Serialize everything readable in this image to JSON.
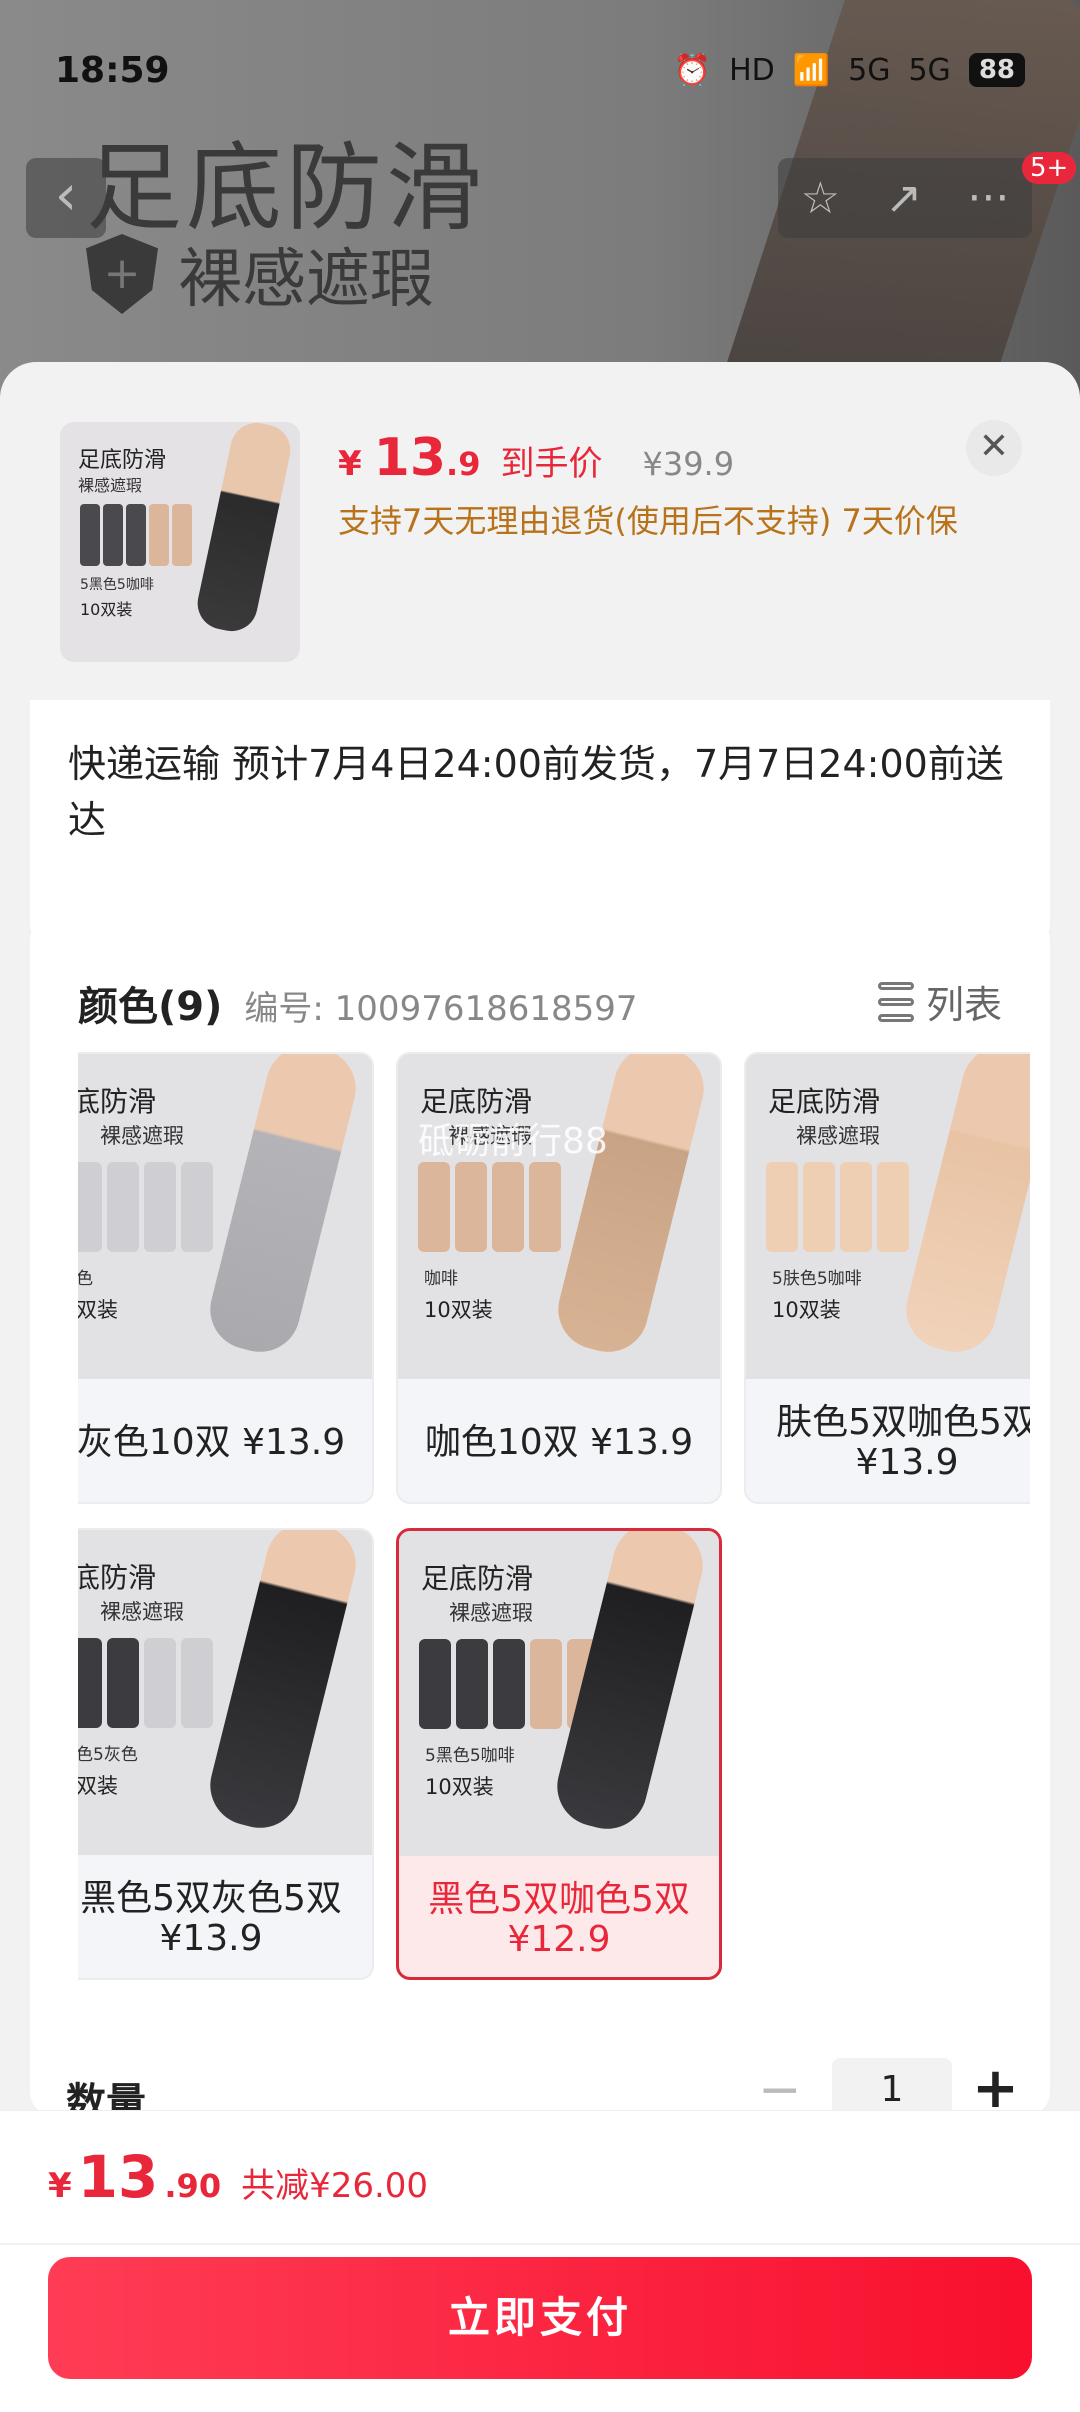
{
  "status_bar": {
    "time": "18:59",
    "hd_label": "HD",
    "network1": "5G",
    "network2": "5G",
    "battery": "88"
  },
  "background": {
    "title": "足底防滑",
    "subtitle": "裸感遮瑕"
  },
  "top_bar": {
    "badge": "5+"
  },
  "product": {
    "thumb_title": "足底防滑",
    "thumb_subtitle": "裸感遮瑕",
    "thumb_line1": "5黑色5咖啡",
    "thumb_line2": "10双装",
    "currency": "¥",
    "price_int": "13",
    "price_dec": ".9",
    "price_tag": "到手价",
    "original_price": "¥39.9",
    "policy": "支持7天无理由退货(使用后不支持) 7天价保"
  },
  "shipping": {
    "text": "快递运输 预计7月4日24:00前发货，7月7日24:00前送达"
  },
  "spec": {
    "title": "颜色(9)",
    "code": "编号: 10097618618597",
    "list_label": "列表",
    "watermark": "砥砺前行88",
    "options": [
      {
        "image_title": "底防滑",
        "image_subtitle": "裸感遮瑕",
        "image_line1": "色",
        "image_line2": "双装",
        "label": "灰色10双 ¥13.9",
        "sock_color": "#cfcfd3",
        "leg_color": "#a9a9ae",
        "selected": false
      },
      {
        "image_title": "足底防滑",
        "image_subtitle": "裸感遮瑕",
        "image_line1": "咖啡",
        "image_line2": "10双装",
        "label": "咖色10双 ¥13.9",
        "sock_color": "#dcb69a",
        "leg_color": "#d7b394",
        "selected": false
      },
      {
        "image_title": "足底防滑",
        "image_subtitle": "裸感遮瑕",
        "image_line1": "5肤色5咖啡",
        "image_line2": "10双装",
        "label": "肤色5双咖色5双 ¥13.9",
        "sock_color": "#efcfb4",
        "leg_color": "#f1d3ba",
        "selected": false
      },
      {
        "image_title": "底防滑",
        "image_subtitle": "裸感遮瑕",
        "image_line1": "色5灰色",
        "image_line2": "双装",
        "label": "黑色5双灰色5双 ¥13.9",
        "sock_color": "#4a4a4e",
        "leg_color": "#2e2e30",
        "selected": false
      },
      {
        "image_title": "足底防滑",
        "image_subtitle": "裸感遮瑕",
        "image_line1": "5黑色5咖啡",
        "image_line2": "10双装",
        "label": "黑色5双咖色5双 ¥12.9",
        "sock_color": "#4a4a4e",
        "leg_color": "#2e2e30",
        "selected": true
      }
    ]
  },
  "quantity": {
    "label": "数量",
    "minus": "−",
    "value": "1",
    "plus": "+"
  },
  "footer": {
    "currency": "¥",
    "price_int": "13",
    "price_dec": ".90",
    "saving": "共减¥26.00",
    "pay_label": "立即支付"
  },
  "colors": {
    "accent": "#e8283a",
    "policy": "#b8731a",
    "selected_bg": "#fde8ea"
  }
}
